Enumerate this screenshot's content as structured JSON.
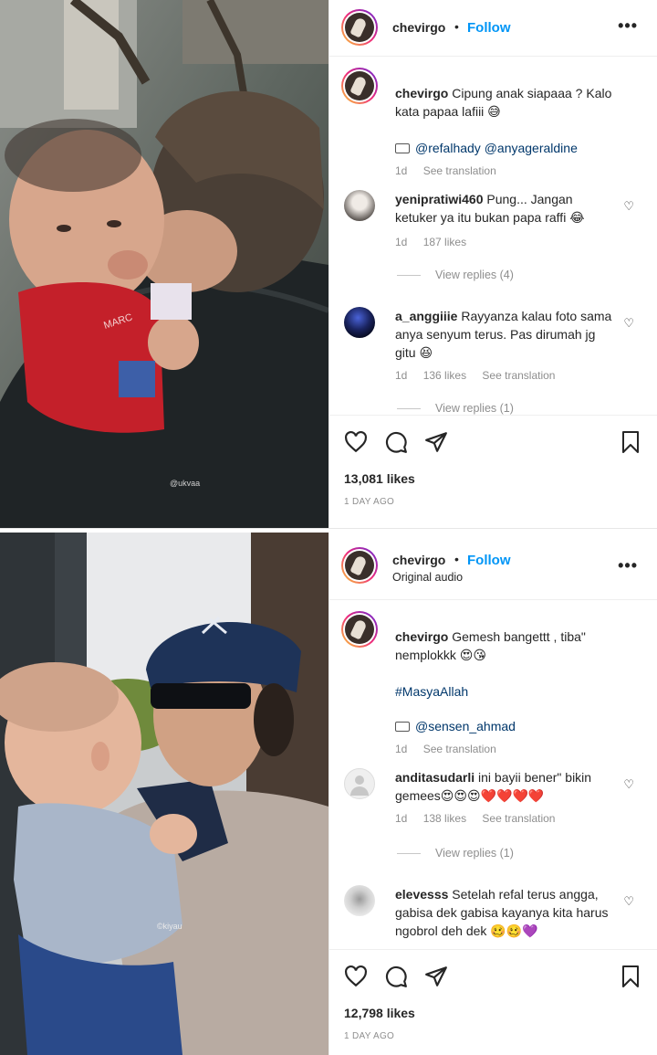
{
  "post1": {
    "username": "chevirgo",
    "follow_label": "Follow",
    "more_label": "•••",
    "caption_user": "chevirgo",
    "caption_text": "Cipung anak siapaaa ? Kalo kata papaa lafiii 😅",
    "tagged": "@refalhady @anyageraldine",
    "caption_time": "1d",
    "see_translation": "See translation",
    "comments": [
      {
        "user": "yenipratiwi460",
        "text": "Pung... Jangan ketuker ya itu bukan papa raffi 😂",
        "time": "1d",
        "likes": "187 likes",
        "view_replies": "View replies (4)"
      },
      {
        "user": "a_anggiiie",
        "text": "Rayyanza kalau foto sama anya senyum terus. Pas dirumah jg gitu 😆",
        "time": "1d",
        "likes": "136 likes",
        "see_translation": "See translation",
        "view_replies": "View replies (1)"
      }
    ],
    "like_count": "13,081 likes",
    "posted_ago": "1 DAY AGO",
    "watermark": "@ukvaa"
  },
  "post2": {
    "username": "chevirgo",
    "follow_label": "Follow",
    "audio": "Original audio",
    "more_label": "•••",
    "caption_user": "chevirgo",
    "caption_text": "Gemesh bangettt , tiba\" nemplokkk 😍😘",
    "hashtag": "#MasyaAllah",
    "tagged": "@sensen_ahmad",
    "caption_time": "1d",
    "see_translation": "See translation",
    "comments": [
      {
        "user": "anditasudarli",
        "text": "ini bayii bener\" bikin gemees😍😍😍❤️❤️❤️❤️",
        "time": "1d",
        "likes": "138 likes",
        "see_translation": "See translation",
        "view_replies": "View replies (1)"
      },
      {
        "user": "elevesss",
        "text": "Setelah refal terus angga, gabisa dek gabisa kayanya kita harus ngobrol deh dek 🥴🥴💜"
      }
    ],
    "like_count": "12,798 likes",
    "posted_ago": "1 DAY AGO",
    "watermark": "©kiyau"
  }
}
